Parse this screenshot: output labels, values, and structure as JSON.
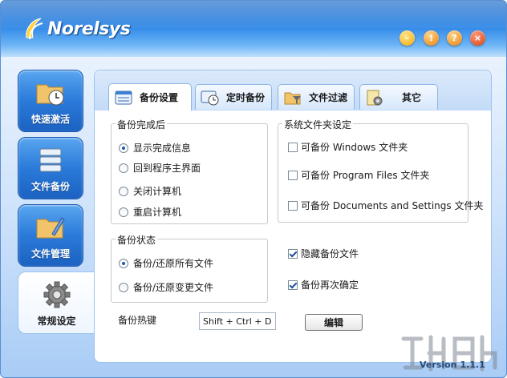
{
  "app": {
    "brand": "Norelsys",
    "version_label": "Version",
    "version_number": "1.1.1"
  },
  "window_buttons": [
    {
      "name": "minimize",
      "glyph": "–"
    },
    {
      "name": "notice",
      "glyph": "!"
    },
    {
      "name": "help",
      "glyph": "?"
    },
    {
      "name": "close",
      "glyph": "×"
    }
  ],
  "sidebar": {
    "items": [
      {
        "label": "快速激活",
        "icon": "folder-clock-icon",
        "active": false
      },
      {
        "label": "文件备份",
        "icon": "drive-stack-icon",
        "active": false
      },
      {
        "label": "文件管理",
        "icon": "folder-pencil-icon",
        "active": false
      },
      {
        "label": "常规设定",
        "icon": "gear-icon",
        "active": true
      }
    ]
  },
  "tabs": [
    {
      "label": "备份设置",
      "icon": "window-icon",
      "active": true
    },
    {
      "label": "定时备份",
      "icon": "clock-window-icon",
      "active": false
    },
    {
      "label": "文件过滤",
      "icon": "folder-filter-icon",
      "active": false
    },
    {
      "label": "其它",
      "icon": "gear-document-icon",
      "active": false
    }
  ],
  "after_backup": {
    "title": "备份完成后",
    "options": [
      "显示完成信息",
      "回到程序主界面",
      "关闭计算机",
      "重启计算机"
    ],
    "selected_index": 0
  },
  "system_folders": {
    "title": "系统文件夹设定",
    "options": [
      {
        "label": "可备份 Windows 文件夹",
        "checked": false
      },
      {
        "label": "可备份 Program Files 文件夹",
        "checked": false
      },
      {
        "label": "可备份 Documents and Settings 文件夹",
        "checked": false
      }
    ]
  },
  "backup_state": {
    "title": "备份状态",
    "options": [
      "备份/还原所有文件",
      "备份/还原变更文件"
    ],
    "selected_index": 0
  },
  "extra_options": [
    {
      "label": "隐藏备份文件",
      "checked": true
    },
    {
      "label": "备份再次确定",
      "checked": true
    }
  ],
  "hotkey": {
    "label": "备份热键",
    "value": "Shift + Ctrl + D",
    "edit_label": "编辑"
  },
  "colors": {
    "accent": "#2a7ad9",
    "titlebar": "#1767c8",
    "panel_border": "#9cc3ee"
  }
}
